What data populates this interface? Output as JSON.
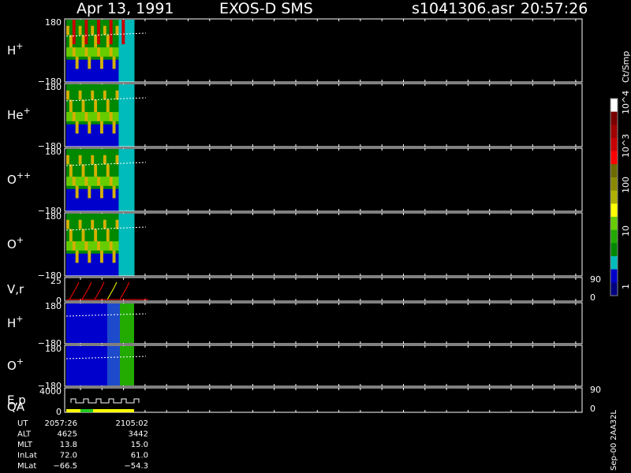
{
  "header": {
    "date": "Apr 13, 1991",
    "instrument": "EXOS-D SMS",
    "file": "s1041306.asr",
    "time": "20:57:26"
  },
  "side_label": "Sep-00 2AA32L",
  "colorbar": {
    "unit": "Ct/Smp",
    "labels": [
      "10^4",
      "10^3",
      "100",
      "10",
      "1"
    ],
    "colors": [
      "#ffffff",
      "#7a0000",
      "#a00000",
      "#c80000",
      "#ff0000",
      "#6b6b00",
      "#8a8a00",
      "#b0b000",
      "#ffff00",
      "#66cc00",
      "#22aa00",
      "#008800",
      "#00bbbb",
      "#0000cc",
      "#000080"
    ]
  },
  "chart_data": {
    "type": "heatmap",
    "panels": [
      {
        "label": "H",
        "sup": "+",
        "ymax": "180",
        "ymin": "−180",
        "kind": "pitch"
      },
      {
        "label": "He",
        "sup": "+",
        "ymax": "180",
        "ymin": "−180",
        "kind": "pitch"
      },
      {
        "label": "O",
        "sup": "++",
        "ymax": "180",
        "ymin": "−180",
        "kind": "pitch"
      },
      {
        "label": "O",
        "sup": "+",
        "ymax": "180",
        "ymin": "−180",
        "kind": "pitch"
      },
      {
        "label": "V,r",
        "sup": "",
        "ymax": "25",
        "ymin": "0",
        "right_max": "90",
        "right_min": "0",
        "kind": "line"
      },
      {
        "label": "H",
        "sup": "+",
        "ymax": "180",
        "ymin": "−180",
        "kind": "flat"
      },
      {
        "label": "O",
        "sup": "+",
        "ymax": "180",
        "ymin": "−180",
        "kind": "flat"
      },
      {
        "label": "E,p",
        "label2": "QA",
        "sup": "",
        "ymax": "4000",
        "ymin": "0",
        "right_max": "90",
        "right_min": "0",
        "kind": "steps"
      }
    ],
    "x_axis": {
      "rows": [
        {
          "name": "UT",
          "start": "2057:26",
          "end": "2105:02"
        },
        {
          "name": "ALT",
          "start": "4625",
          "end": "3442"
        },
        {
          "name": "MLT",
          "start": "13.8",
          "end": "15.0"
        },
        {
          "name": "InLat",
          "start": "72.0",
          "end": "61.0"
        },
        {
          "name": "MLat",
          "start": "−66.5",
          "end": "−54.3"
        }
      ]
    }
  }
}
